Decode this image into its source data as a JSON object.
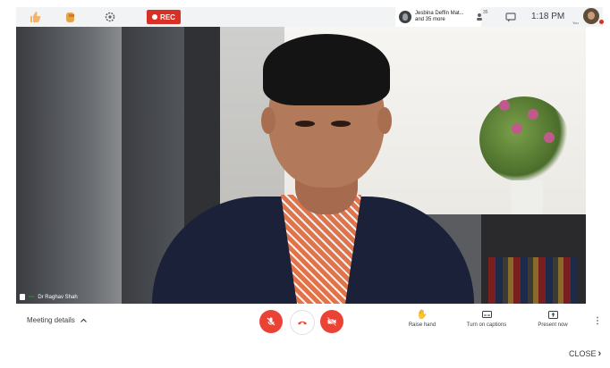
{
  "topbar": {
    "rec_label": "REC",
    "participants_line1": "Jesbina Deffin Mat...",
    "participants_line2": "and 35 more",
    "participant_count": "35",
    "time": "1:18 PM",
    "you_label": "You"
  },
  "video": {
    "speaker_name": "Dr Raghav Shah"
  },
  "bottombar": {
    "meeting_details_label": "Meeting details",
    "raise_hand_label": "Raise hand",
    "captions_label": "Turn on captions",
    "present_label": "Present now"
  },
  "footer": {
    "close_label": "CLOSE"
  },
  "colors": {
    "rec": "#d93025",
    "control_red": "#ea4335",
    "speaking_green": "#1e8e3e"
  }
}
